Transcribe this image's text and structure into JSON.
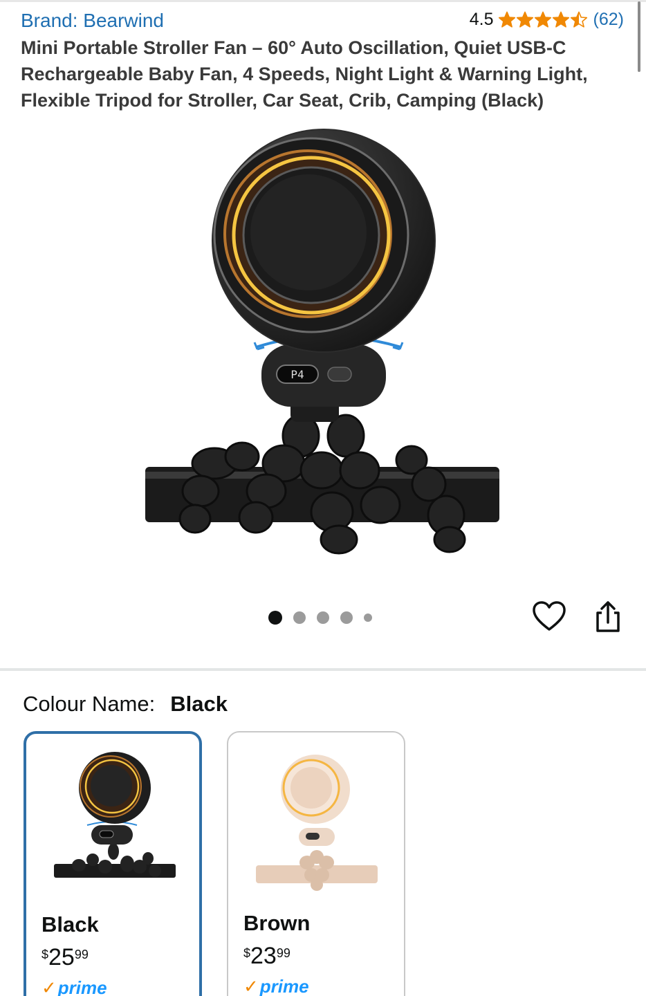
{
  "product": {
    "brand_label": "Brand: Bearwind",
    "rating_value": "4.5",
    "rating_stars": 4.5,
    "rating_count": "(62)",
    "title": "Mini Portable Stroller Fan – 60° Auto Oscillation, Quiet USB-C Rechargeable Baby Fan, 4 Speeds, Night Light & Warning Light, Flexible Tripod for Stroller, Car Seat, Crib, Camping (Black)",
    "display_readout": "P4"
  },
  "gallery": {
    "image_count": 5,
    "active_index": 0
  },
  "actions": {
    "favorite_icon": "heart-icon",
    "share_icon": "share-icon"
  },
  "variation": {
    "label": "Colour Name:",
    "selected": "Black",
    "options": [
      {
        "name": "Black",
        "price_symbol": "$",
        "price_whole": "25",
        "price_fraction": "99",
        "prime": "prime",
        "selected": true
      },
      {
        "name": "Brown",
        "price_symbol": "$",
        "price_whole": "23",
        "price_fraction": "99",
        "prime": "prime",
        "selected": false
      }
    ]
  },
  "colors": {
    "link": "#1f6fb2",
    "star": "#f08804",
    "selected_border": "#2f6fa7",
    "prime_blue": "#1a98ff"
  }
}
